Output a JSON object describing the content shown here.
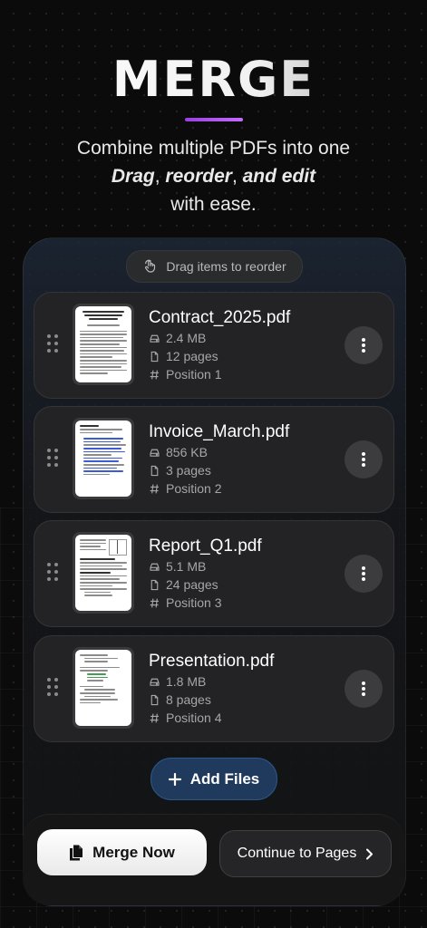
{
  "hero": {
    "title": "MERGE",
    "line1": "Combine multiple PDFs into one",
    "drag": "Drag",
    "comma1": ", ",
    "reorder": "reorder",
    "comma2": ", ",
    "and_edit": "and edit",
    "line3": "with ease."
  },
  "hint": {
    "label": "Drag items to reorder",
    "icon": "hand-pointer-icon"
  },
  "files": [
    {
      "name": "Contract_2025.pdf",
      "size": "2.4 MB",
      "pages": "12 pages",
      "position": "Position 1"
    },
    {
      "name": "Invoice_March.pdf",
      "size": "856 KB",
      "pages": "3 pages",
      "position": "Position 2"
    },
    {
      "name": "Report_Q1.pdf",
      "size": "5.1 MB",
      "pages": "24 pages",
      "position": "Position 3"
    },
    {
      "name": "Presentation.pdf",
      "size": "1.8 MB",
      "pages": "8 pages",
      "position": "Position 4"
    }
  ],
  "actions": {
    "add_files": "Add Files",
    "merge_now": "Merge Now",
    "continue": "Continue to Pages"
  },
  "colors": {
    "background": "#0b0b0c",
    "accent_purple": "#9b3fe0",
    "add_button": "#1f3a5c",
    "card": "#232325"
  }
}
